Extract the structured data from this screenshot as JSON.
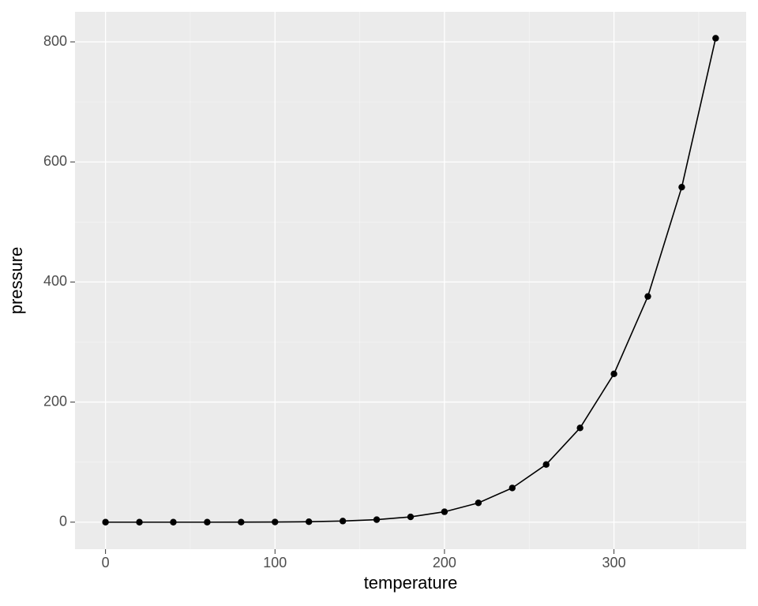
{
  "chart_data": {
    "type": "line",
    "x": [
      0,
      20,
      40,
      60,
      80,
      100,
      120,
      140,
      160,
      180,
      200,
      220,
      240,
      260,
      280,
      300,
      320,
      340,
      360
    ],
    "y": [
      0.0002,
      0.0012,
      0.006,
      0.03,
      0.09,
      0.27,
      0.75,
      1.85,
      4.2,
      8.8,
      17.3,
      32.1,
      57,
      96,
      157,
      247,
      376,
      558,
      806
    ],
    "xlabel": "temperature",
    "ylabel": "pressure",
    "xlim": [
      -18,
      378
    ],
    "ylim": [
      -45,
      850
    ],
    "x_ticks": [
      0,
      100,
      200,
      300
    ],
    "y_ticks": [
      0,
      200,
      400,
      600,
      800
    ],
    "x_minor": [
      50,
      150,
      250,
      350
    ],
    "y_minor": [
      100,
      300,
      500,
      700
    ],
    "x_tick_labels": [
      "0",
      "100",
      "200",
      "300"
    ],
    "y_tick_labels": [
      "0",
      "200",
      "400",
      "600",
      "800"
    ],
    "grid": true,
    "title": ""
  }
}
